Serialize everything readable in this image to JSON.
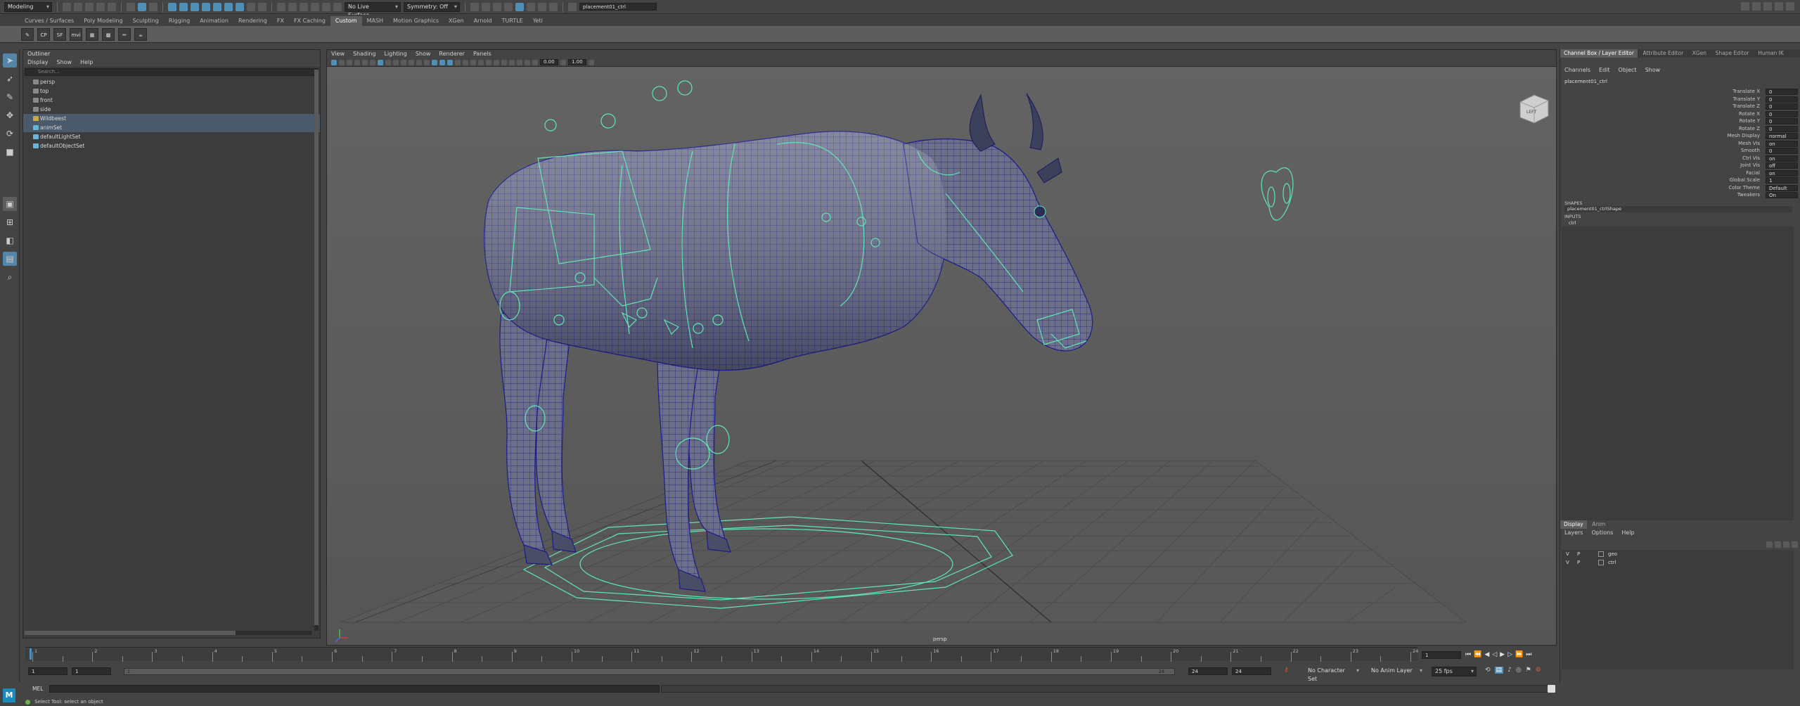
{
  "status_line": {
    "menu_set": "Modeling",
    "live_surface": "No Live Surface",
    "symmetry": "Symmetry: Off",
    "selection_field": "placement01_ctrl"
  },
  "shelf": {
    "tabs": [
      "Curves / Surfaces",
      "Poly Modeling",
      "Sculpting",
      "Rigging",
      "Animation",
      "Rendering",
      "FX",
      "FX Caching",
      "Custom",
      "MASH",
      "Motion Graphics",
      "XGen",
      "Arnold",
      "TURTLE",
      "Yeti"
    ],
    "active_tab": "Custom",
    "icons": [
      "CP",
      "SF",
      "mvi"
    ]
  },
  "outliner": {
    "title": "Outliner",
    "menu": [
      "Display",
      "Show",
      "Help"
    ],
    "search_placeholder": "Search...",
    "items": [
      {
        "label": "persp",
        "type": "camera",
        "selected": false
      },
      {
        "label": "top",
        "type": "camera",
        "selected": false
      },
      {
        "label": "front",
        "type": "camera",
        "selected": false
      },
      {
        "label": "side",
        "type": "camera",
        "selected": false
      },
      {
        "label": "Wildbeest",
        "type": "group",
        "selected": true
      },
      {
        "label": "animSet",
        "type": "set",
        "selected": true
      },
      {
        "label": "defaultLightSet",
        "type": "set",
        "selected": false
      },
      {
        "label": "defaultObjectSet",
        "type": "set",
        "selected": false
      }
    ]
  },
  "viewport": {
    "menu": [
      "View",
      "Shading",
      "Lighting",
      "Show",
      "Renderer",
      "Panels"
    ],
    "field_a": "0.00",
    "field_b": "1.00",
    "camera_label": "persp",
    "view_cube": "LEFT"
  },
  "channel_box": {
    "tabs": [
      "Channel Box / Layer Editor",
      "Attribute Editor",
      "XGen",
      "Shape Editor",
      "Human IK"
    ],
    "menu": [
      "Channels",
      "Edit",
      "Object",
      "Show"
    ],
    "object_name": "placement01_ctrl",
    "attributes": [
      {
        "label": "Translate X",
        "value": "0"
      },
      {
        "label": "Translate Y",
        "value": "0"
      },
      {
        "label": "Translate Z",
        "value": "0"
      },
      {
        "label": "Rotate X",
        "value": "0"
      },
      {
        "label": "Rotate Y",
        "value": "0"
      },
      {
        "label": "Rotate Z",
        "value": "0"
      },
      {
        "label": "Mesh Display",
        "value": "normal"
      },
      {
        "label": "Mesh Vis",
        "value": "on"
      },
      {
        "label": "Smooth",
        "value": "0"
      },
      {
        "label": "Ctrl Vis",
        "value": "on"
      },
      {
        "label": "Joint Vis",
        "value": "off"
      },
      {
        "label": "Facial",
        "value": "on"
      },
      {
        "label": "Global Scale",
        "value": "1"
      },
      {
        "label": "Color Theme",
        "value": "Default"
      },
      {
        "label": "Tweakers",
        "value": "On"
      }
    ],
    "shapes_header": "SHAPES",
    "shape_name": "placement01_ctrlShape",
    "inputs_header": "INPUTS",
    "input_name": "ctrl"
  },
  "layer_editor": {
    "tabs": [
      "Display",
      "Anim"
    ],
    "menu": [
      "Layers",
      "Options",
      "Help"
    ],
    "layers": [
      {
        "v": "V",
        "p": "P",
        "name": "geo"
      },
      {
        "v": "V",
        "p": "P",
        "name": "ctrl"
      }
    ]
  },
  "time_slider": {
    "ticks": [
      "1",
      "",
      "2",
      "",
      "3",
      "",
      "4",
      "",
      "5",
      "",
      "6",
      "",
      "7",
      "",
      "8",
      "",
      "9",
      "",
      "10",
      "",
      "11",
      "",
      "12",
      "",
      "13",
      "",
      "14",
      "",
      "15",
      "",
      "16",
      "",
      "17",
      "",
      "18",
      "",
      "19",
      "",
      "20",
      "",
      "21",
      "",
      "22",
      "",
      "23",
      "",
      "24"
    ],
    "current_frame": "1"
  },
  "range_slider": {
    "start": "1",
    "inner_start": "1",
    "range_start_label": "1",
    "range_end_label": "24",
    "inner_end": "24",
    "end": "24",
    "character_set": "No Character Set",
    "anim_layer": "No Anim Layer",
    "fps": "25 fps"
  },
  "command_line": {
    "lang": "MEL"
  },
  "help_line": {
    "text": "Select Tool: select an object"
  },
  "colors": {
    "accent": "#5285a6",
    "rig_controls": "#5fe6b4",
    "mesh_wire": "#1c1c8a"
  }
}
